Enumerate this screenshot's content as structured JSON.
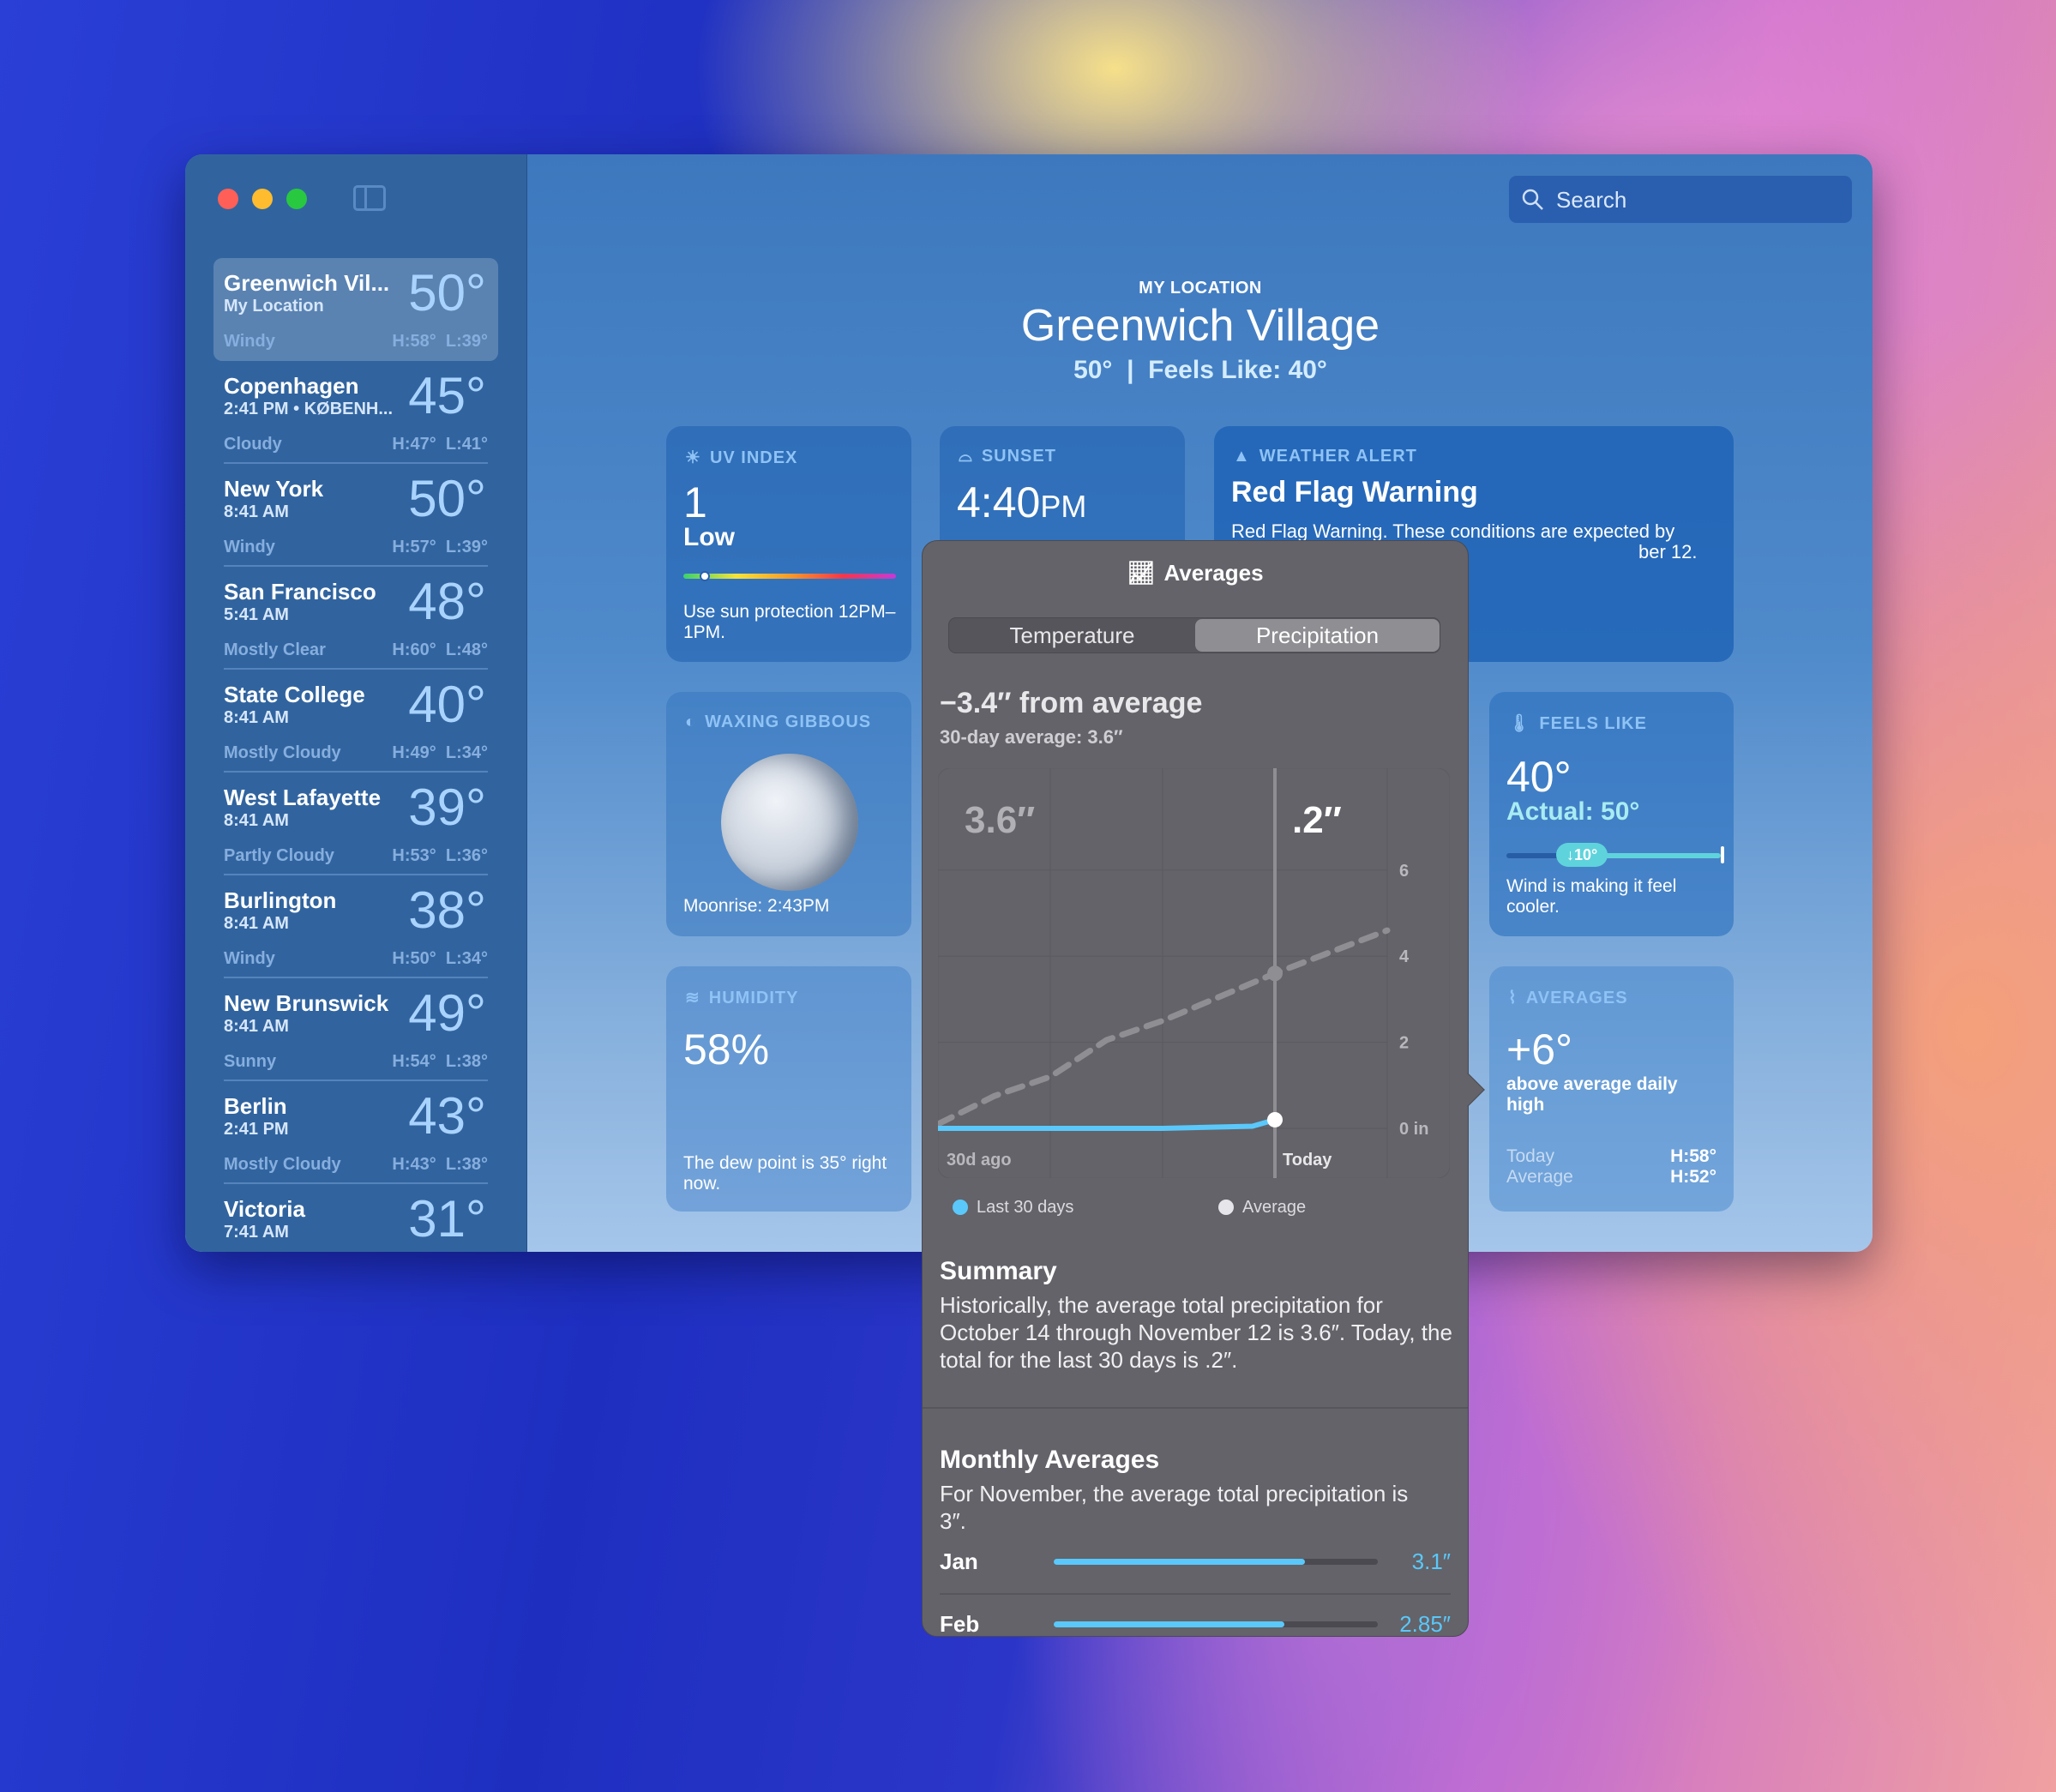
{
  "window_controls": {
    "close": "#ff5f57",
    "minimize": "#febc2e",
    "zoom": "#28c840"
  },
  "search": {
    "placeholder": "Search"
  },
  "sidebar": {
    "items": [
      {
        "name": "Greenwich Vil...",
        "subtitle": "My Location",
        "temp": "50°",
        "condition": "Windy",
        "hilo": "H:58°  L:39°",
        "selected": true
      },
      {
        "name": "Copenhagen",
        "subtitle": "2:41 PM  •  KØBENH...",
        "temp": "45°",
        "condition": "Cloudy",
        "hilo": "H:47°  L:41°"
      },
      {
        "name": "New York",
        "subtitle": "8:41 AM",
        "temp": "50°",
        "condition": "Windy",
        "hilo": "H:57°  L:39°"
      },
      {
        "name": "San Francisco",
        "subtitle": "5:41 AM",
        "temp": "48°",
        "condition": "Mostly Clear",
        "hilo": "H:60°  L:48°"
      },
      {
        "name": "State College",
        "subtitle": "8:41 AM",
        "temp": "40°",
        "condition": "Mostly Cloudy",
        "hilo": "H:49°  L:34°"
      },
      {
        "name": "West Lafayette",
        "subtitle": "8:41 AM",
        "temp": "39°",
        "condition": "Partly Cloudy",
        "hilo": "H:53°  L:36°"
      },
      {
        "name": "Burlington",
        "subtitle": "8:41 AM",
        "temp": "38°",
        "condition": "Windy",
        "hilo": "H:50°  L:34°"
      },
      {
        "name": "New Brunswick",
        "subtitle": "8:41 AM",
        "temp": "49°",
        "condition": "Sunny",
        "hilo": "H:54°  L:38°"
      },
      {
        "name": "Berlin",
        "subtitle": "2:41 PM",
        "temp": "43°",
        "condition": "Mostly Cloudy",
        "hilo": "H:43°  L:38°"
      },
      {
        "name": "Victoria",
        "subtitle": "7:41 AM",
        "temp": "31°"
      }
    ]
  },
  "header": {
    "kicker": "MY LOCATION",
    "city": "Greenwich Village",
    "summary": "50°  |  Feels Like: 40°"
  },
  "cards": {
    "uv": {
      "label": "UV INDEX",
      "value": "1",
      "level": "Low",
      "level_fraction": 0.1,
      "note": "Use sun protection 12PM–1PM."
    },
    "sunset": {
      "label": "SUNSET",
      "time": "4:40",
      "ampm": "PM"
    },
    "alert": {
      "label": "WEATHER ALERT",
      "title": "Red Flag Warning",
      "line1": "Red Flag Warning. These conditions are expected by",
      "line2": "ber 12."
    },
    "moon": {
      "label": "WAXING GIBBOUS",
      "moonrise": "Moonrise: 2:43PM"
    },
    "feels": {
      "label": "FEELS LIKE",
      "value": "40°",
      "actual": "Actual: 50°",
      "delta": "↓10°",
      "note": "Wind is making it feel cooler."
    },
    "humidity": {
      "label": "HUMIDITY",
      "value": "58%",
      "note": "The dew point is 35° right now."
    },
    "averages": {
      "label": "AVERAGES",
      "value": "+6°",
      "note": "above average daily high",
      "today_label": "Today",
      "today_value": "H:58°",
      "avg_label": "Average",
      "avg_value": "H:52°"
    }
  },
  "popover": {
    "title": "Averages",
    "tabs": [
      {
        "label": "Temperature",
        "selected": false
      },
      {
        "label": "Precipitation",
        "selected": true
      }
    ],
    "headline": "−3.4″ from average",
    "subhead": "30-day average: 3.6″",
    "legend": [
      {
        "label": "Last 30 days",
        "color": "#5ac8fa"
      },
      {
        "label": "Average",
        "color": "#e5e5ea"
      }
    ],
    "summary_title": "Summary",
    "summary_text": "Historically, the average total precipitation for October 14 through November 12 is 3.6″. Today, the total for the last 30 days is .2″.",
    "monthly_title": "Monthly Averages",
    "monthly_text": "For November, the average total precipitation is 3″.",
    "monthly": [
      {
        "month": "Jan",
        "value": 3.1,
        "label": "3.1″"
      },
      {
        "month": "Feb",
        "value": 2.85,
        "label": "2.85″"
      }
    ],
    "monthly_max": 4
  },
  "chart_data": {
    "type": "line",
    "x_labels": {
      "start": "30d ago",
      "today": "Today"
    },
    "value_labels": {
      "average": "3.6″",
      "last_30_days": ".2″"
    },
    "y_ticks": [
      "0 in",
      "2",
      "4",
      "6"
    ],
    "ylim": [
      0,
      6
    ],
    "xlim": [
      -30,
      10
    ],
    "grid": true,
    "legend": "bottom",
    "series": [
      {
        "name": "Average",
        "style": "dashed",
        "color": "#8e8e93",
        "x": [
          -30,
          -25,
          -20,
          -15,
          -10,
          -5,
          0,
          5,
          10
        ],
        "y": [
          0.1,
          0.75,
          1.2,
          2.05,
          2.5,
          3.05,
          3.6,
          4.1,
          4.6
        ]
      },
      {
        "name": "Last 30 days",
        "style": "solid",
        "color": "#5ac8fa",
        "x": [
          -30,
          -20,
          -10,
          -2,
          0
        ],
        "y": [
          0,
          0,
          0,
          0.05,
          0.2
        ]
      }
    ]
  }
}
